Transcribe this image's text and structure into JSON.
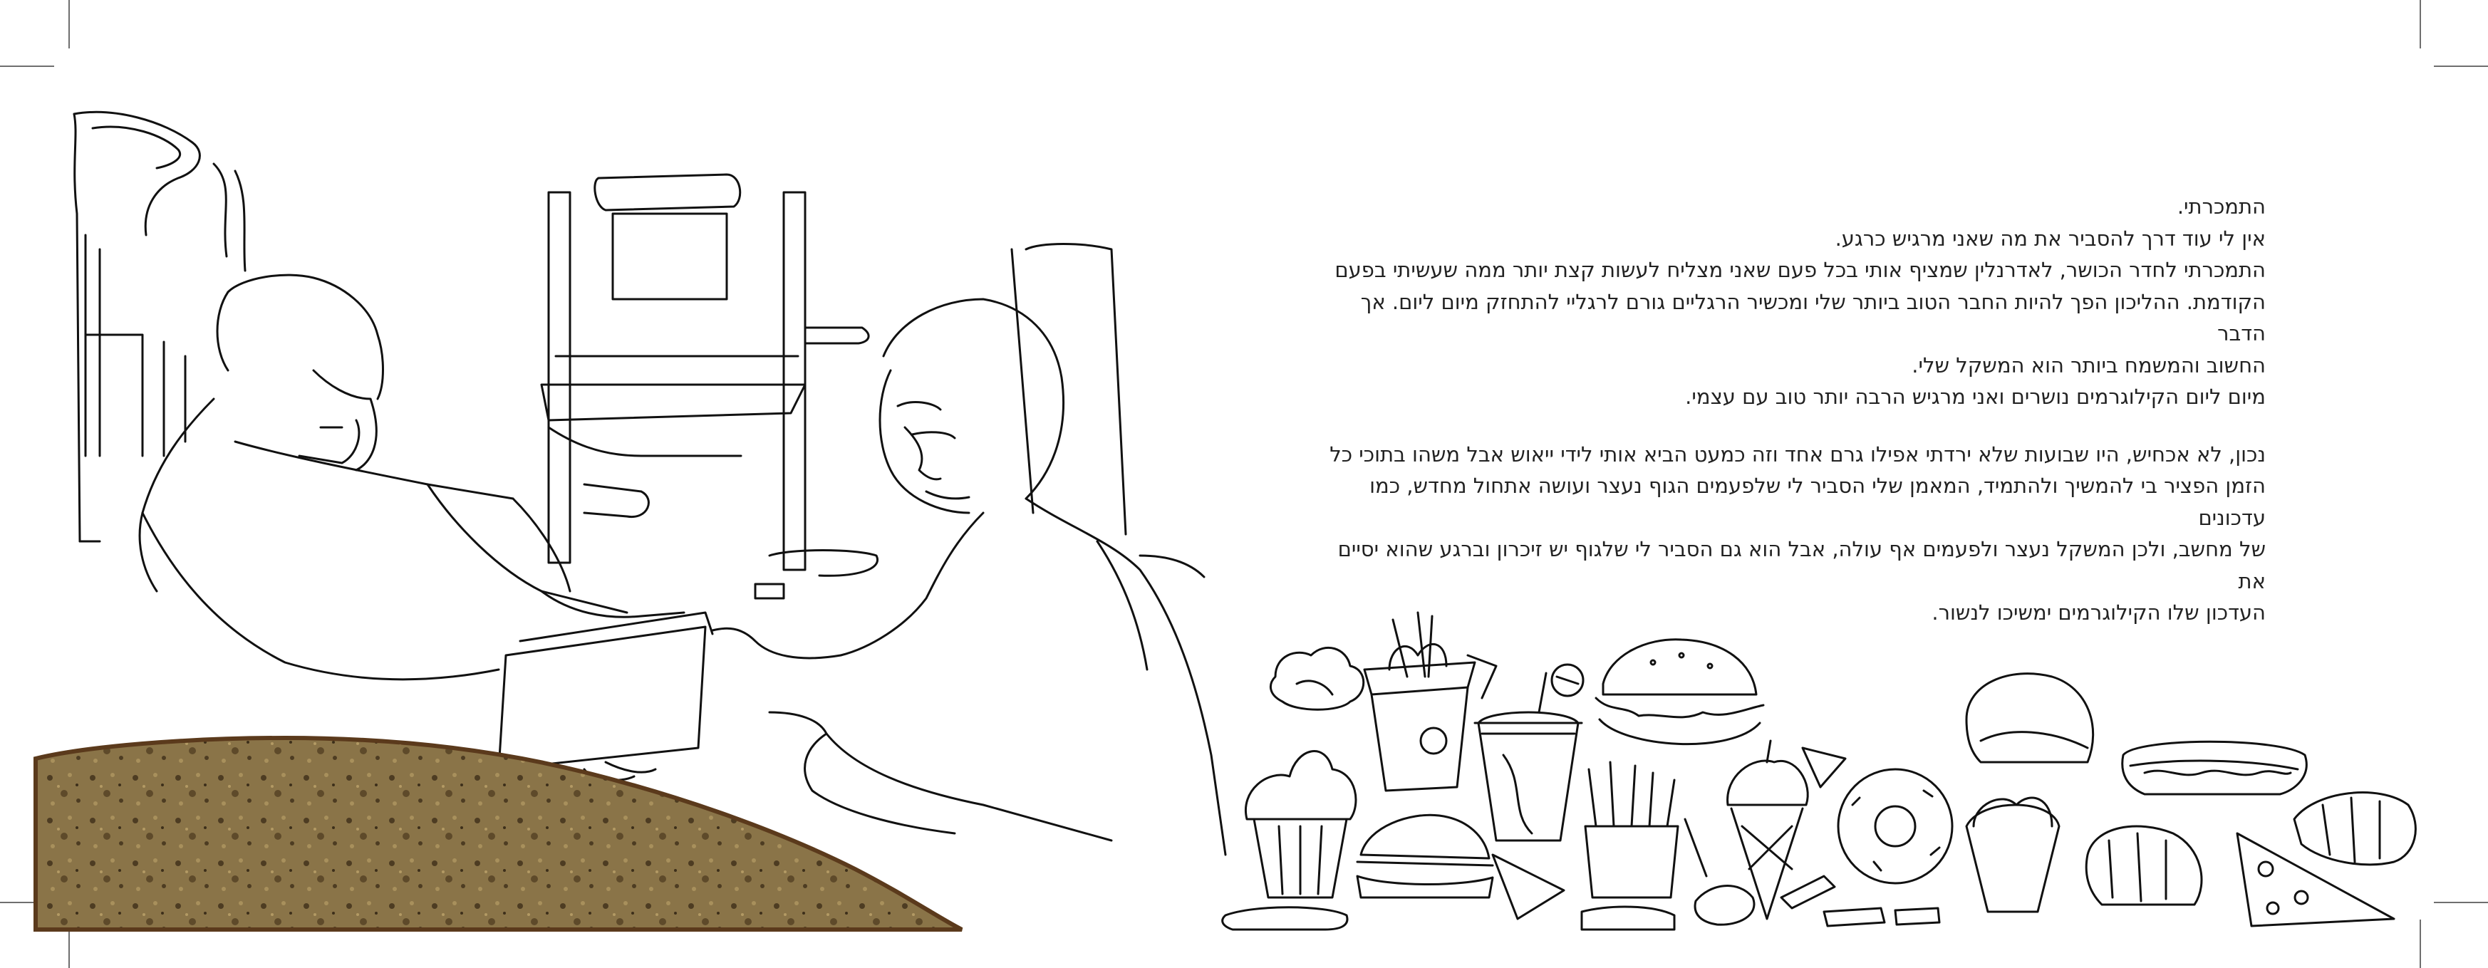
{
  "page": {
    "paragraph1": [
      "התמכרתי.",
      "אין לי עוד דרך להסביר את מה שאני מרגיש כרגע.",
      "התמכרתי לחדר הכושר, לאדרנלין שמציף אותי בכל פעם שאני מצליח לעשות קצת יותר ממה שעשיתי בפעם",
      "הקודמת. ההליכון הפך להיות החבר הטוב ביותר שלי ומכשיר הרגליים גורם לרגליי להתחזק מיום ליום. אך הדבר",
      "החשוב והמשמח ביותר הוא המשקל שלי.",
      "מיום ליום הקילוגרמים נושרים ואני מרגיש הרבה יותר טוב עם עצמי."
    ],
    "paragraph2": [
      "נכון, לא אכחיש, היו שבועות שלא ירדתי אפילו גרם אחד וזה כמעט הביא אותי לידי ייאוש אבל משהו בתוכי כל",
      "הזמן הפציר בי להמשיך ולהתמיד, המאמן שלי הסביר לי שלפעמים הגוף נעצר ועושה אתחול מחדש, כמו עדכונים",
      "של מחשב, ולכן המשקל נעצר ולפעמים אף עולה, אבל הוא גם הסביר לי שלגוף יש זיכרון וברגע שהוא יסיים את",
      "העדכון שלו הקילוגרמים ימשיכו לנשור."
    ]
  },
  "illustration": {
    "left_scene": "coach-handing-notebook-to-man-in-gym-icon",
    "right_scene": "junk-food-doodles-icon",
    "bread_texture": "bread-texture-icon",
    "colors": {
      "line": "#111111",
      "bread_base": "#8a7448",
      "bread_dark": "#4d3c22",
      "bread_crust": "#5b3a1c"
    }
  }
}
